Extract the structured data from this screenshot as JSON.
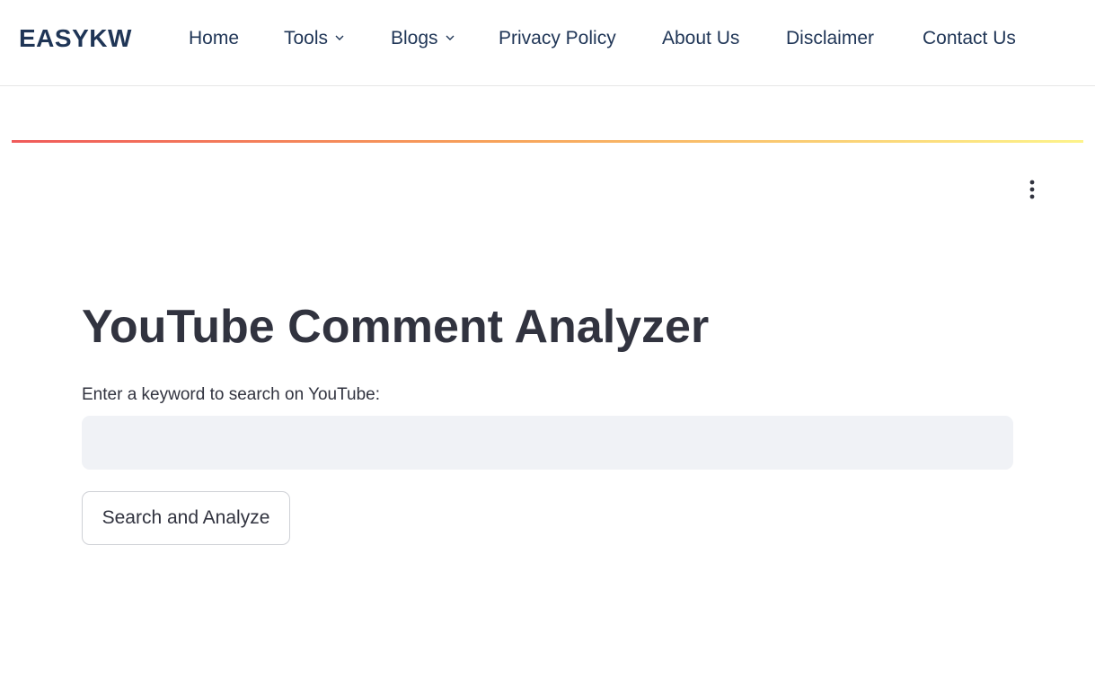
{
  "navbar": {
    "logo": "EASYKW",
    "items": [
      {
        "label": "Home",
        "has_dropdown": false
      },
      {
        "label": "Tools",
        "has_dropdown": true
      },
      {
        "label": "Blogs",
        "has_dropdown": true
      },
      {
        "label": "Privacy Policy",
        "has_dropdown": false
      },
      {
        "label": "About Us",
        "has_dropdown": false
      },
      {
        "label": "Disclaimer",
        "has_dropdown": false
      },
      {
        "label": "Contact Us",
        "has_dropdown": false
      }
    ]
  },
  "main": {
    "menu_icon": "kebab-menu-icon",
    "title": "YouTube Comment Analyzer",
    "search": {
      "label": "Enter a keyword to search on YouTube:",
      "value": "",
      "placeholder": ""
    },
    "button_label": "Search and Analyze"
  },
  "colors": {
    "nav_text": "#1f3556",
    "body_text": "#31333f",
    "input_bg": "#f0f2f6",
    "gradient_start": "#f05a5a",
    "gradient_end": "#fdf38a"
  }
}
